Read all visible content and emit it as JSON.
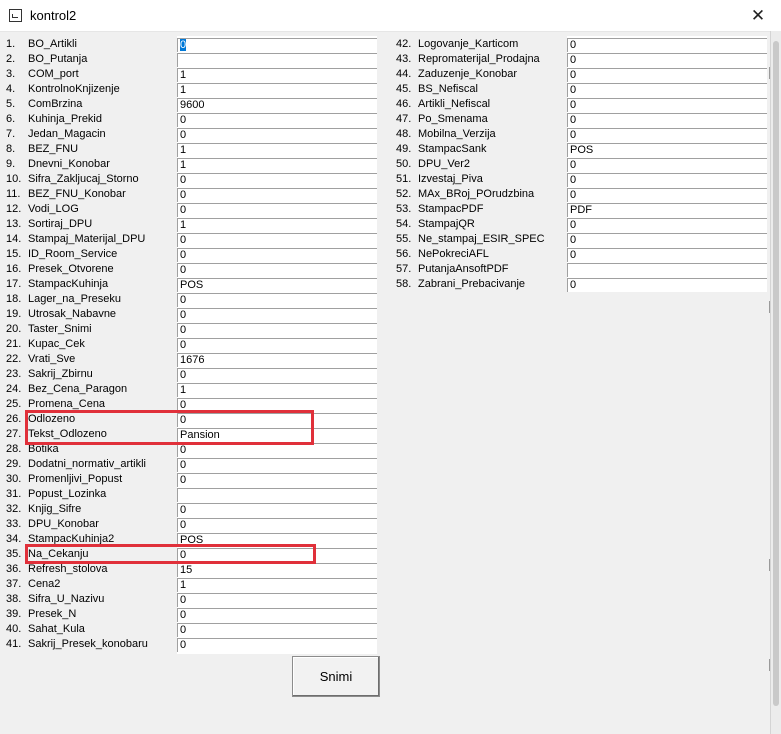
{
  "window": {
    "title": "kontrol2",
    "close_glyph": "✕"
  },
  "left_fields": [
    {
      "num": "1.",
      "label": "BO_Artikli",
      "value": "0",
      "selected": true
    },
    {
      "num": "2.",
      "label": "BO_Putanja",
      "value": ""
    },
    {
      "num": "3.",
      "label": "COM_port",
      "value": "1"
    },
    {
      "num": "4.",
      "label": "KontrolnoKnjizenje",
      "value": "1"
    },
    {
      "num": "5.",
      "label": "ComBrzina",
      "value": "9600"
    },
    {
      "num": "6.",
      "label": "Kuhinja_Prekid",
      "value": "0"
    },
    {
      "num": "7.",
      "label": "Jedan_Magacin",
      "value": "0"
    },
    {
      "num": "8.",
      "label": "BEZ_FNU",
      "value": "1"
    },
    {
      "num": "9.",
      "label": "Dnevni_Konobar",
      "value": "1"
    },
    {
      "num": "10.",
      "label": "Sifra_Zakljucaj_Storno",
      "value": "0"
    },
    {
      "num": "11.",
      "label": "BEZ_FNU_Konobar",
      "value": "0"
    },
    {
      "num": "12.",
      "label": "Vodi_LOG",
      "value": "0"
    },
    {
      "num": "13.",
      "label": "Sortiraj_DPU",
      "value": "1"
    },
    {
      "num": "14.",
      "label": "Stampaj_Materijal_DPU",
      "value": "0"
    },
    {
      "num": "15.",
      "label": "ID_Room_Service",
      "value": "0"
    },
    {
      "num": "16.",
      "label": "Presek_Otvorene",
      "value": "0"
    },
    {
      "num": "17.",
      "label": "StampacKuhinja",
      "value": "POS"
    },
    {
      "num": "18.",
      "label": "Lager_na_Preseku",
      "value": "0"
    },
    {
      "num": "19.",
      "label": "Utrosak_Nabavne",
      "value": "0"
    },
    {
      "num": "20.",
      "label": "Taster_Snimi",
      "value": "0"
    },
    {
      "num": "21.",
      "label": "Kupac_Cek",
      "value": "0"
    },
    {
      "num": "22.",
      "label": "Vrati_Sve",
      "value": "1676"
    },
    {
      "num": "23.",
      "label": "Sakrij_Zbirnu",
      "value": "0"
    },
    {
      "num": "24.",
      "label": "Bez_Cena_Paragon",
      "value": "1"
    },
    {
      "num": "25.",
      "label": "Promena_Cena",
      "value": "0"
    },
    {
      "num": "26.",
      "label": "Odlozeno",
      "value": "0"
    },
    {
      "num": "27.",
      "label": "Tekst_Odlozeno",
      "value": "Pansion"
    },
    {
      "num": "28.",
      "label": "Botika",
      "value": "0"
    },
    {
      "num": "29.",
      "label": "Dodatni_normativ_artikli",
      "value": "0"
    },
    {
      "num": "30.",
      "label": "Promenljivi_Popust",
      "value": "0"
    },
    {
      "num": "31.",
      "label": "Popust_Lozinka",
      "value": ""
    },
    {
      "num": "32.",
      "label": "Knjig_Sifre",
      "value": "0"
    },
    {
      "num": "33.",
      "label": "DPU_Konobar",
      "value": "0"
    },
    {
      "num": "34.",
      "label": "StampacKuhinja2",
      "value": "POS"
    },
    {
      "num": "35.",
      "label": "Na_Cekanju",
      "value": "0"
    },
    {
      "num": "36.",
      "label": "Refresh_stolova",
      "value": "15"
    },
    {
      "num": "37.",
      "label": "Cena2",
      "value": "1"
    },
    {
      "num": "38.",
      "label": "Sifra_U_Nazivu",
      "value": "0"
    },
    {
      "num": "39.",
      "label": "Presek_N",
      "value": "0"
    },
    {
      "num": "40.",
      "label": "Sahat_Kula",
      "value": "0"
    },
    {
      "num": "41.",
      "label": "Sakrij_Presek_konobaru",
      "value": "0"
    }
  ],
  "right_fields": [
    {
      "num": "42.",
      "label": "Logovanje_Karticom",
      "value": "0"
    },
    {
      "num": "43.",
      "label": "Repromaterijal_Prodajna",
      "value": "0"
    },
    {
      "num": "44.",
      "label": "Zaduzenje_Konobar",
      "value": "0"
    },
    {
      "num": "45.",
      "label": "BS_Nefiscal",
      "value": "0"
    },
    {
      "num": "46.",
      "label": "Artikli_Nefiscal",
      "value": "0"
    },
    {
      "num": "47.",
      "label": "Po_Smenama",
      "value": "0"
    },
    {
      "num": "48.",
      "label": "Mobilna_Verzija",
      "value": "0"
    },
    {
      "num": "49.",
      "label": "StampacSank",
      "value": "POS"
    },
    {
      "num": "50.",
      "label": "DPU_Ver2",
      "value": "0"
    },
    {
      "num": "51.",
      "label": "Izvestaj_Piva",
      "value": "0"
    },
    {
      "num": "52.",
      "label": "MAx_BRoj_POrudzbina",
      "value": "0"
    },
    {
      "num": "53.",
      "label": "StampacPDF",
      "value": "PDF"
    },
    {
      "num": "54.",
      "label": "StampajQR",
      "value": "0"
    },
    {
      "num": "55.",
      "label": "Ne_stampaj_ESIR_SPEC",
      "value": "0"
    },
    {
      "num": "56.",
      "label": "NePokreciAFL",
      "value": "0"
    },
    {
      "num": "57.",
      "label": "PutanjaAnsoftPDF",
      "value": ""
    },
    {
      "num": "58.",
      "label": "Zabrani_Prebacivanje",
      "value": "0"
    }
  ],
  "buttons": {
    "save_label": "Snimi"
  },
  "colors": {
    "highlight": "#e0303a",
    "selection": "#0078d7"
  }
}
